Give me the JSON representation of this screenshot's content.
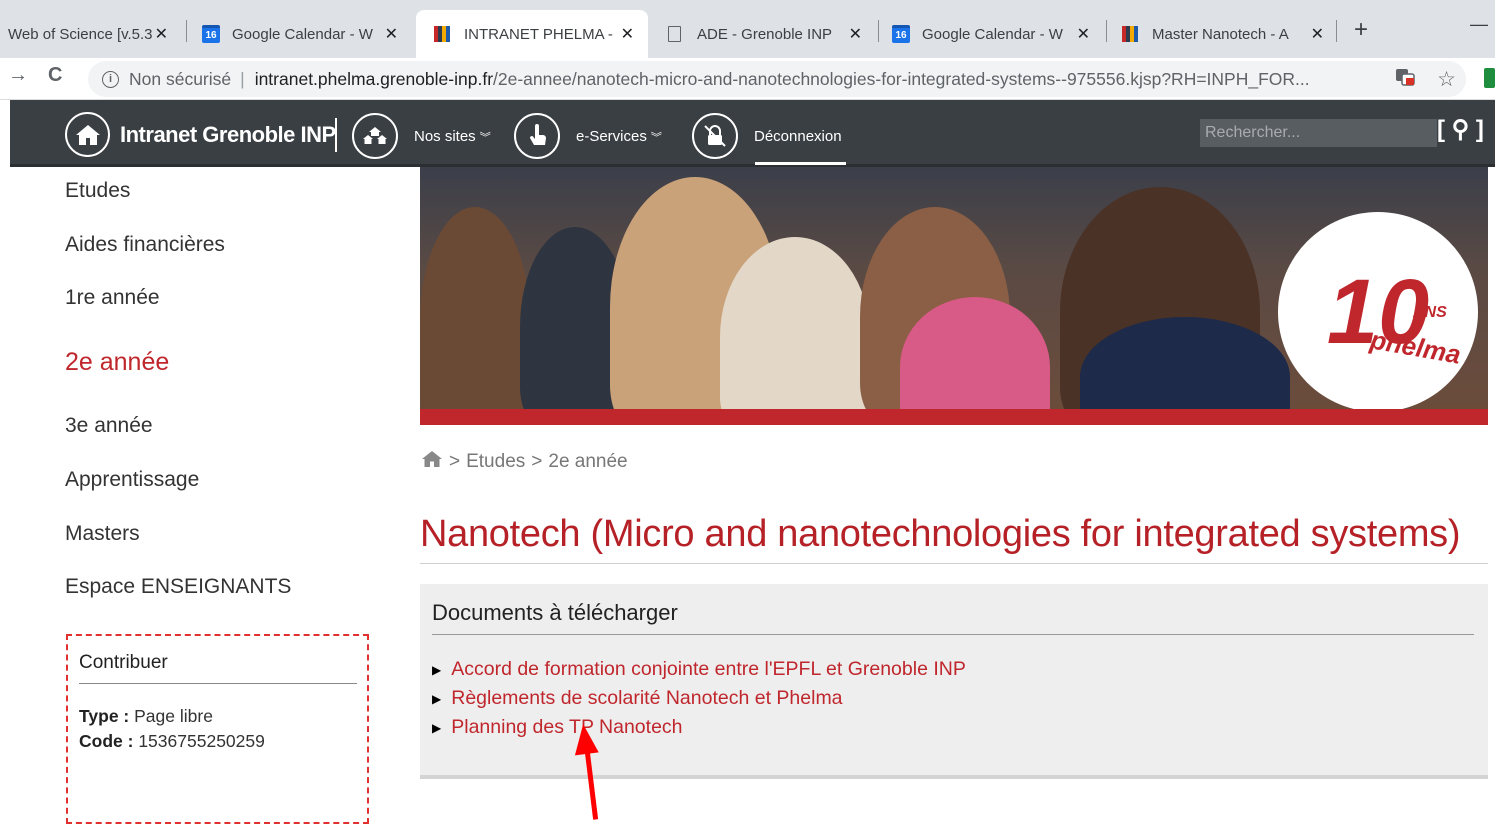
{
  "browser": {
    "tabs": [
      {
        "title": "Web of Science [v.5.3",
        "favicon": "wos-icon"
      },
      {
        "title": "Google Calendar - W",
        "favicon": "calendar-icon",
        "favicon_text": "16"
      },
      {
        "title": "INTRANET PHELMA - ",
        "favicon": "intranet-icon",
        "active": true
      },
      {
        "title": "ADE - Grenoble INP",
        "favicon": "document-icon"
      },
      {
        "title": "Google Calendar - W",
        "favicon": "calendar-icon",
        "favicon_text": "16"
      },
      {
        "title": "Master Nanotech - A",
        "favicon": "intranet-icon"
      }
    ],
    "close_glyph": "✕",
    "new_tab_glyph": "+",
    "minimize_glyph": "—",
    "back_glyph": "→",
    "reload_glyph": "C",
    "address": {
      "info_glyph": "i",
      "security_label": "Non sécurisé",
      "host": "intranet.phelma.grenoble-inp.fr",
      "path": "/2e-annee/nanotech-micro-and-nanotechnologies-for-integrated-systems--975556.kjsp?RH=INPH_FOR..."
    }
  },
  "site": {
    "brand": "Intranet Grenoble INP",
    "nav": [
      {
        "label": "Nos sites"
      },
      {
        "label": "e-Services"
      },
      {
        "label": "Déconnexion"
      }
    ],
    "search_placeholder": "Rechercher...",
    "search_glyph": "[ ⚲ ]"
  },
  "sidebar": {
    "items": [
      {
        "label": "Etudes"
      },
      {
        "label": "Aides financières"
      },
      {
        "label": "1re année"
      },
      {
        "label": "2e année",
        "active": true
      },
      {
        "label": "3e année"
      },
      {
        "label": "Apprentissage"
      },
      {
        "label": "Masters"
      },
      {
        "label": "Espace ENSEIGNANTS"
      }
    ],
    "contribute": {
      "title": "Contribuer",
      "type_label": "Type :",
      "type_value": "Page libre",
      "code_label": "Code :",
      "code_value": "1536755250259"
    }
  },
  "banner": {
    "logo_number": "10",
    "logo_ans": "ANS",
    "logo_name": "phelma"
  },
  "breadcrumb": {
    "sep": ">",
    "items": [
      "Etudes",
      "2e année"
    ]
  },
  "main": {
    "title": "Nanotech (Micro and nanotechnologies for integrated systems)",
    "documents": {
      "heading": "Documents à télécharger",
      "bullet": "▶",
      "items": [
        "Accord de formation conjointe entre l'EPFL et Grenoble INP",
        "Règlements de scolarité Nanotech et Phelma",
        "Planning des TP Nanotech"
      ]
    }
  },
  "colors": {
    "accent": "#c0272d",
    "header_bg": "#3a3f43",
    "annotation": "#ff0000"
  }
}
